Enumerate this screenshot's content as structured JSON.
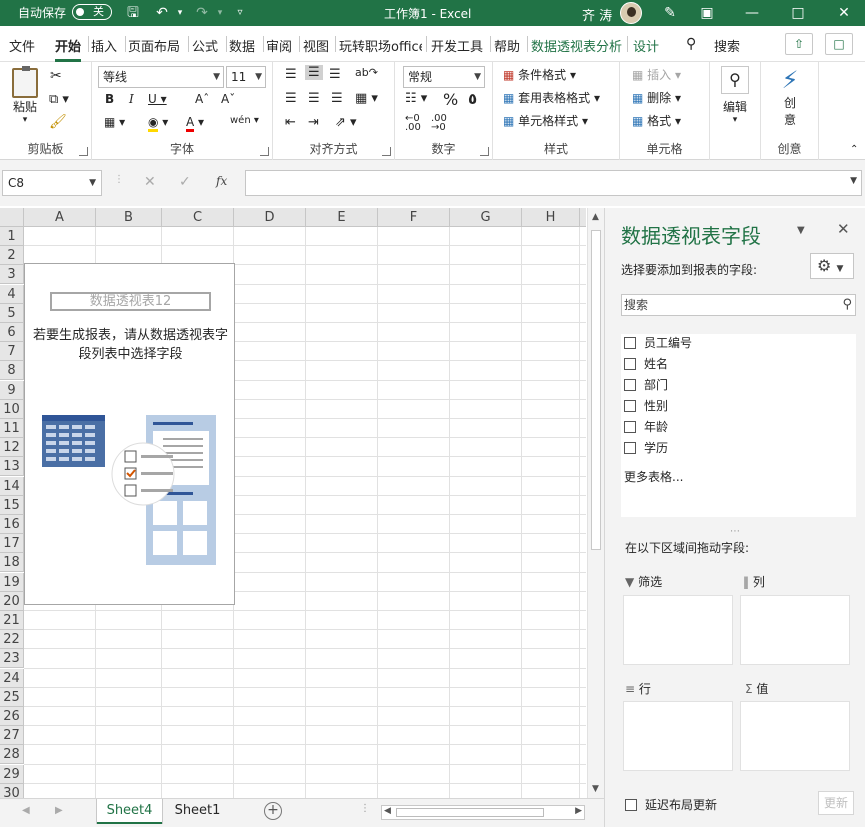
{
  "titlebar": {
    "autosave_label": "自动保存",
    "autosave_state": "关",
    "doc_title": "工作簿1  -  Excel",
    "user": "齐 涛"
  },
  "menu": {
    "tabs": [
      "文件",
      "开始",
      "插入",
      "页面布局",
      "公式",
      "数据",
      "审阅",
      "视图",
      "玩转职场office",
      "开发工具",
      "帮助",
      "数据透视表分析",
      "设计"
    ],
    "active": "开始",
    "search": "搜索"
  },
  "ribbon": {
    "clipboard": {
      "paste": "粘贴",
      "label": "剪贴板"
    },
    "font": {
      "name": "等线",
      "size": "11",
      "label": "字体"
    },
    "alignment": {
      "label": "对齐方式"
    },
    "number": {
      "format": "常规",
      "label": "数字"
    },
    "styles": {
      "conditional": "条件格式",
      "table": "套用表格格式",
      "cell": "单元格样式",
      "label": "样式"
    },
    "cells": {
      "insert": "插入",
      "delete": "删除",
      "format": "格式",
      "label": "单元格"
    },
    "editing": {
      "label": "编辑"
    },
    "ideas": {
      "label1": "创",
      "label2": "意",
      "group": "创意"
    }
  },
  "formula": {
    "namebox": "C8",
    "fx": "fx",
    "value": ""
  },
  "grid": {
    "columns": [
      "A",
      "B",
      "C",
      "D",
      "E",
      "F",
      "G",
      "H"
    ],
    "rows": [
      "1",
      "2",
      "3",
      "4",
      "5",
      "6",
      "7",
      "8",
      "9",
      "10",
      "11",
      "12",
      "13",
      "14",
      "15",
      "16",
      "17",
      "18",
      "19",
      "20",
      "21",
      "22",
      "23",
      "24",
      "25",
      "26",
      "27",
      "28",
      "29",
      "30"
    ]
  },
  "pivot_placeholder": {
    "name": "数据透视表12",
    "message": "若要生成报表，请从数据透视表字段列表中选择字段"
  },
  "sheets": {
    "tabs": [
      "Sheet4",
      "Sheet1"
    ],
    "active": "Sheet4"
  },
  "pane": {
    "title": "数据透视表字段",
    "subtitle": "选择要添加到报表的字段:",
    "search_placeholder": "搜索",
    "fields": [
      "员工编号",
      "姓名",
      "部门",
      "性别",
      "年龄",
      "学历"
    ],
    "more_tables": "更多表格...",
    "drag_text": "在以下区域间拖动字段:",
    "zones": {
      "filter": "筛选",
      "columns": "列",
      "rows": "行",
      "values": "值"
    },
    "defer_update": "延迟布局更新",
    "update_button": "更新"
  }
}
